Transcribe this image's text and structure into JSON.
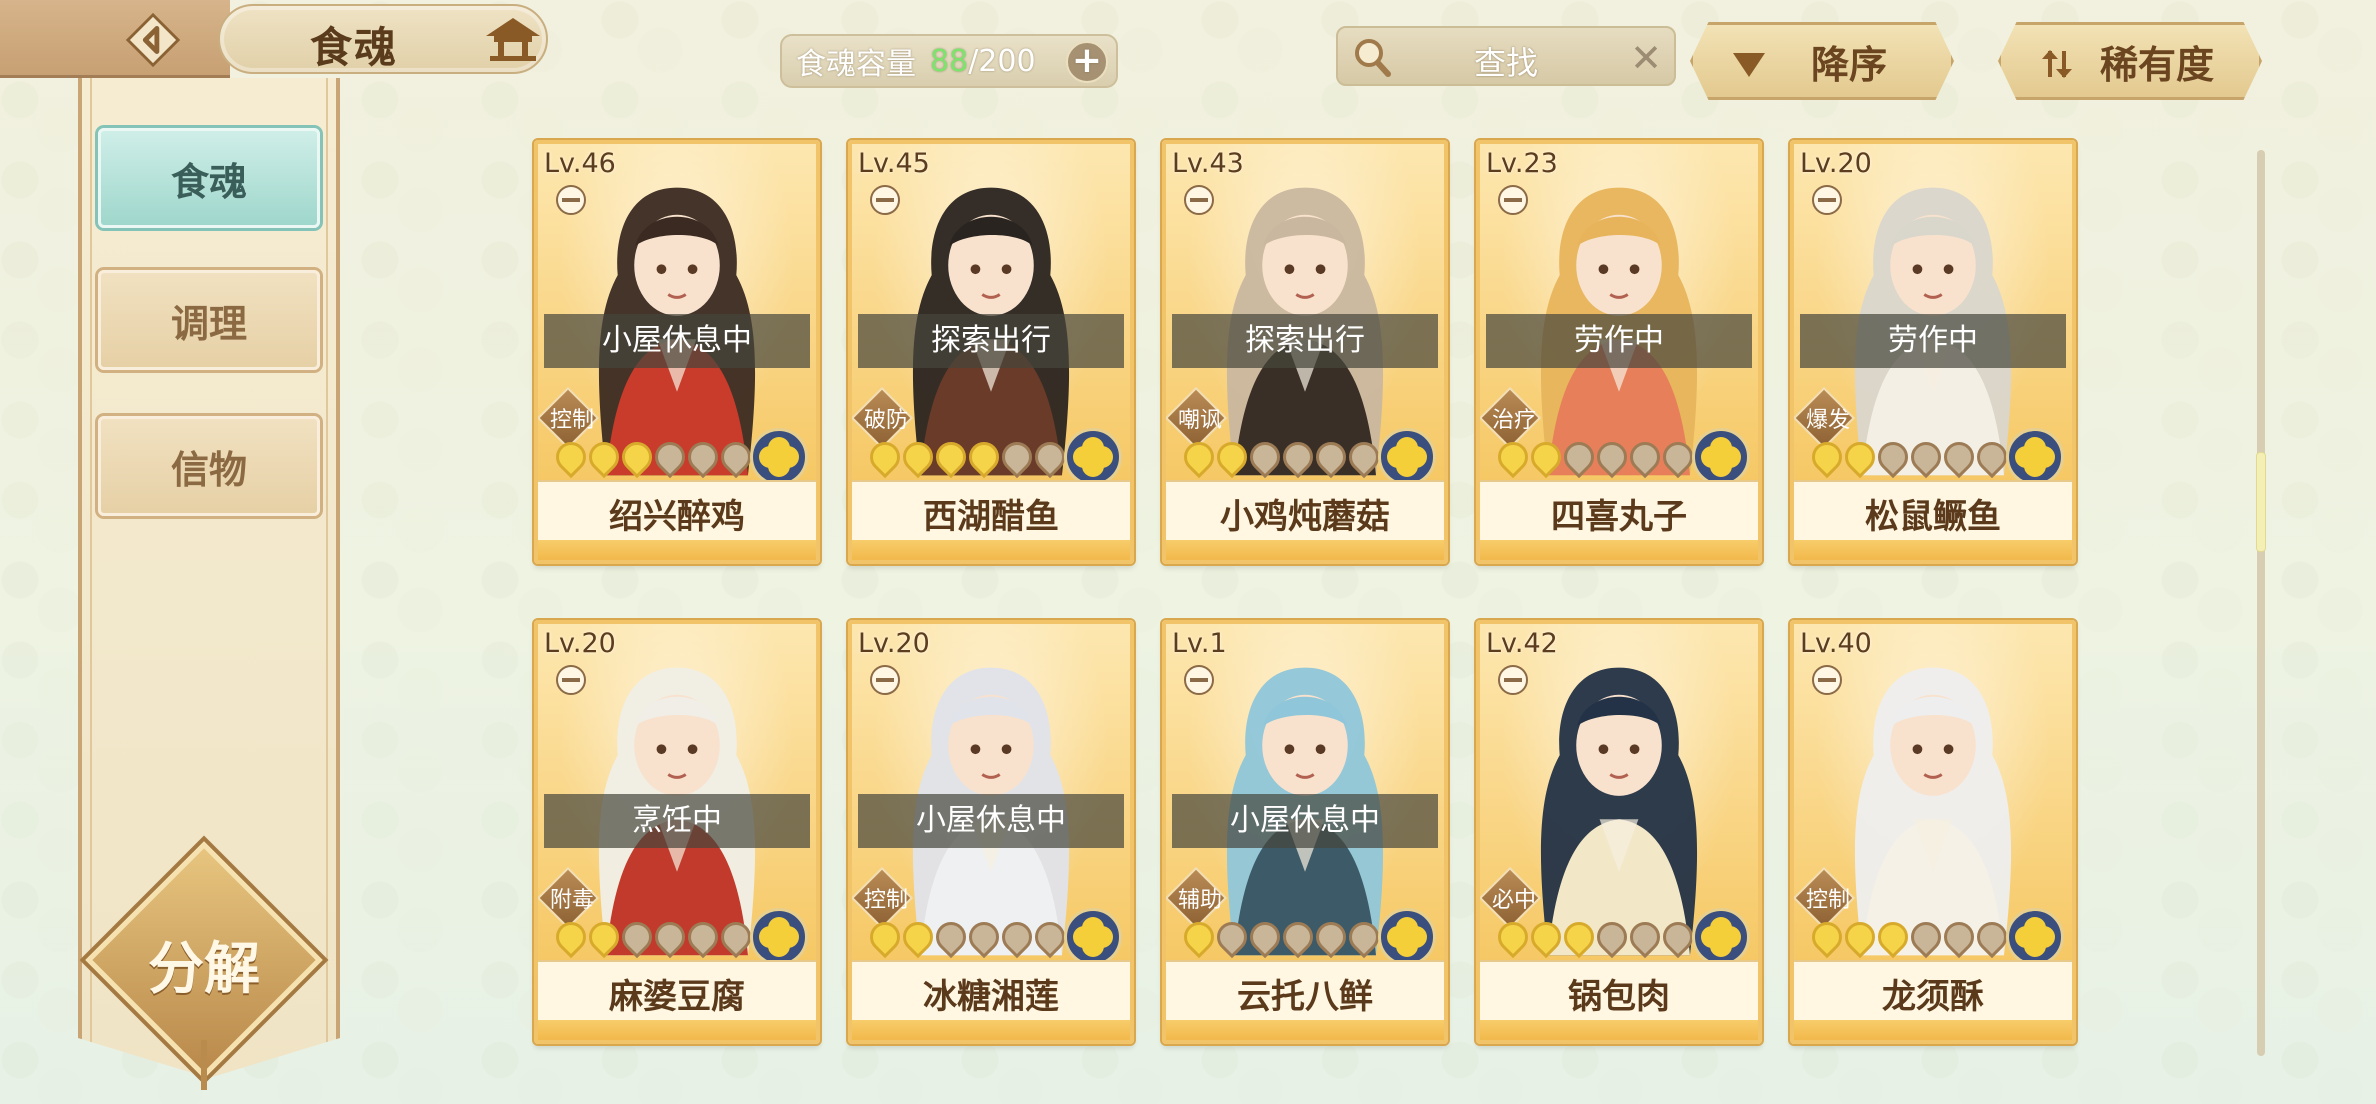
{
  "header": {
    "title": "食魂",
    "capacity": {
      "label": "食魂容量",
      "current": "88",
      "separator": "/",
      "max": "200"
    },
    "search": {
      "placeholder": "查找"
    },
    "sort_desc_label": "降序",
    "sort_rarity_label": "稀有度"
  },
  "sidebar": {
    "tabs": [
      {
        "label": "食魂",
        "active": true
      },
      {
        "label": "调理",
        "active": false
      },
      {
        "label": "信物",
        "active": false
      }
    ],
    "decompose_label": "分解"
  },
  "cards": [
    {
      "level": "Lv.46",
      "status": "小屋休息中",
      "role": "控制",
      "name": "绍兴醉鸡",
      "rarity": 3,
      "hair": "#3b2a22",
      "outfit": "#c93b2b"
    },
    {
      "level": "Lv.45",
      "status": "探索出行",
      "role": "破防",
      "name": "西湖醋鱼",
      "rarity": 4,
      "hair": "#2a2420",
      "outfit": "#6b3b2a"
    },
    {
      "level": "Lv.43",
      "status": "探索出行",
      "role": "嘲讽",
      "name": "小鸡炖蘑菇",
      "rarity": 2,
      "hair": "#c9b79f",
      "outfit": "#3a2f27"
    },
    {
      "level": "Lv.23",
      "status": "劳作中",
      "role": "治疗",
      "name": "四喜丸子",
      "rarity": 2,
      "hair": "#e7b45b",
      "outfit": "#e77f5a"
    },
    {
      "level": "Lv.20",
      "status": "劳作中",
      "role": "爆发",
      "name": "松鼠鳜鱼",
      "rarity": 2,
      "hair": "#d9d6cc",
      "outfit": "#f3efe4"
    },
    {
      "level": "Lv.20",
      "status": "烹饪中",
      "role": "附毒",
      "name": "麻婆豆腐",
      "rarity": 2,
      "hair": "#f0eee6",
      "outfit": "#c23a2b"
    },
    {
      "level": "Lv.20",
      "status": "小屋休息中",
      "role": "控制",
      "name": "冰糖湘莲",
      "rarity": 2,
      "hair": "#e0e3ea",
      "outfit": "#eef0f2"
    },
    {
      "level": "Lv.1",
      "status": "小屋休息中",
      "role": "辅助",
      "name": "云托八鲜",
      "rarity": 1,
      "hair": "#8fc6d9",
      "outfit": "#3d5a68"
    },
    {
      "level": "Lv.42",
      "status": "",
      "role": "必中",
      "name": "锅包肉",
      "rarity": 3,
      "hair": "#233246",
      "outfit": "#f2e7c7"
    },
    {
      "level": "Lv.40",
      "status": "",
      "role": "控制",
      "name": "龙须酥",
      "rarity": 3,
      "hair": "#eeeeee",
      "outfit": "#f5f1e6"
    }
  ],
  "colors": {
    "accent_green": "#7de36d",
    "card_gold": "#f7cc70",
    "active_tab": "#9fd7cc"
  }
}
